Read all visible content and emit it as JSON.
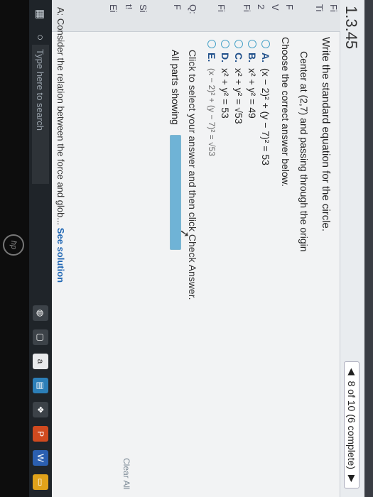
{
  "header": {
    "question_number": "1.3.45",
    "progress_label": "8 of 10 (6 complete)",
    "prev_arrow": "◀",
    "next_arrow": "▶"
  },
  "rail_letters": [
    "Fi",
    "Ti",
    "F",
    "V",
    "2",
    "Fi",
    "Fi",
    "Q:",
    "F",
    "Si",
    "t!",
    "Ei",
    "A:"
  ],
  "question": {
    "prompt": "Write the standard equation for the circle.",
    "given": "Center at (2,7) and passing through the origin",
    "instruction": "Choose the correct answer below.",
    "options": [
      {
        "letter": "A.",
        "equation": "(x − 2)² + (y − 7)² = 53"
      },
      {
        "letter": "B.",
        "equation": "x² + y² = 49"
      },
      {
        "letter": "C.",
        "equation": "x² + y² = √53"
      },
      {
        "letter": "D.",
        "equation": "x² + y² = 53"
      },
      {
        "letter": "E.",
        "equation": "(x − 2)² + (y − 7)² = √53"
      }
    ],
    "check_instruction": "Click to select your answer and then click Check Answer.",
    "parts_label": "All parts showing",
    "parts_progress": 1.0,
    "clear_all": "Clear All"
  },
  "footer": {
    "prefix": "A:",
    "text": "Consider the relation between the force and glob...",
    "link": "See solution"
  },
  "taskbar": {
    "search_placeholder": "Type here to search"
  },
  "colors": {
    "accent": "#4aa3c8",
    "link": "#1f66b3"
  }
}
